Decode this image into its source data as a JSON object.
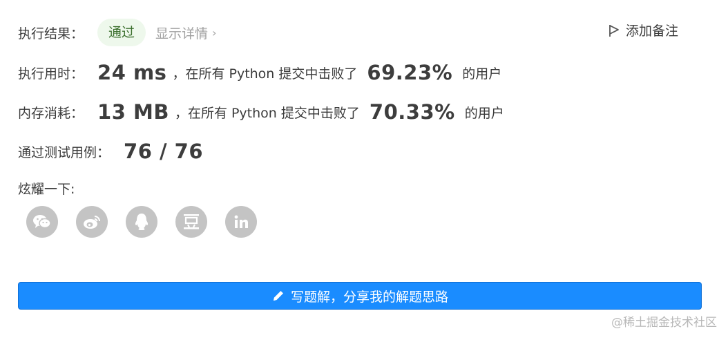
{
  "result": {
    "label": "执行结果：",
    "status": "通过",
    "details_link": "显示详情",
    "details_chevron": "›",
    "add_note": "添加备注"
  },
  "runtime": {
    "label": "执行用时：",
    "value": "24 ms",
    "text": "，在所有 Python 提交中击败了",
    "percent": "69.23%",
    "suffix": "的用户"
  },
  "memory": {
    "label": "内存消耗：",
    "value": "13 MB",
    "text": "，在所有 Python 提交中击败了",
    "percent": "70.33%",
    "suffix": "的用户"
  },
  "tests": {
    "label": "通过测试用例：",
    "value": "76 / 76"
  },
  "share": {
    "label": "炫耀一下:",
    "icons": [
      "wechat-icon",
      "weibo-icon",
      "qq-icon",
      "douban-icon",
      "linkedin-icon"
    ]
  },
  "write_solution": {
    "label": "写题解，分享我的解题思路"
  },
  "watermark": "@稀土掘金技术社区",
  "colors": {
    "pass_badge_bg": "#eef8ec",
    "pass_text": "#3b6f2d",
    "primary_button": "#1a8cff",
    "social_icon_bg": "#c4c4c4"
  }
}
